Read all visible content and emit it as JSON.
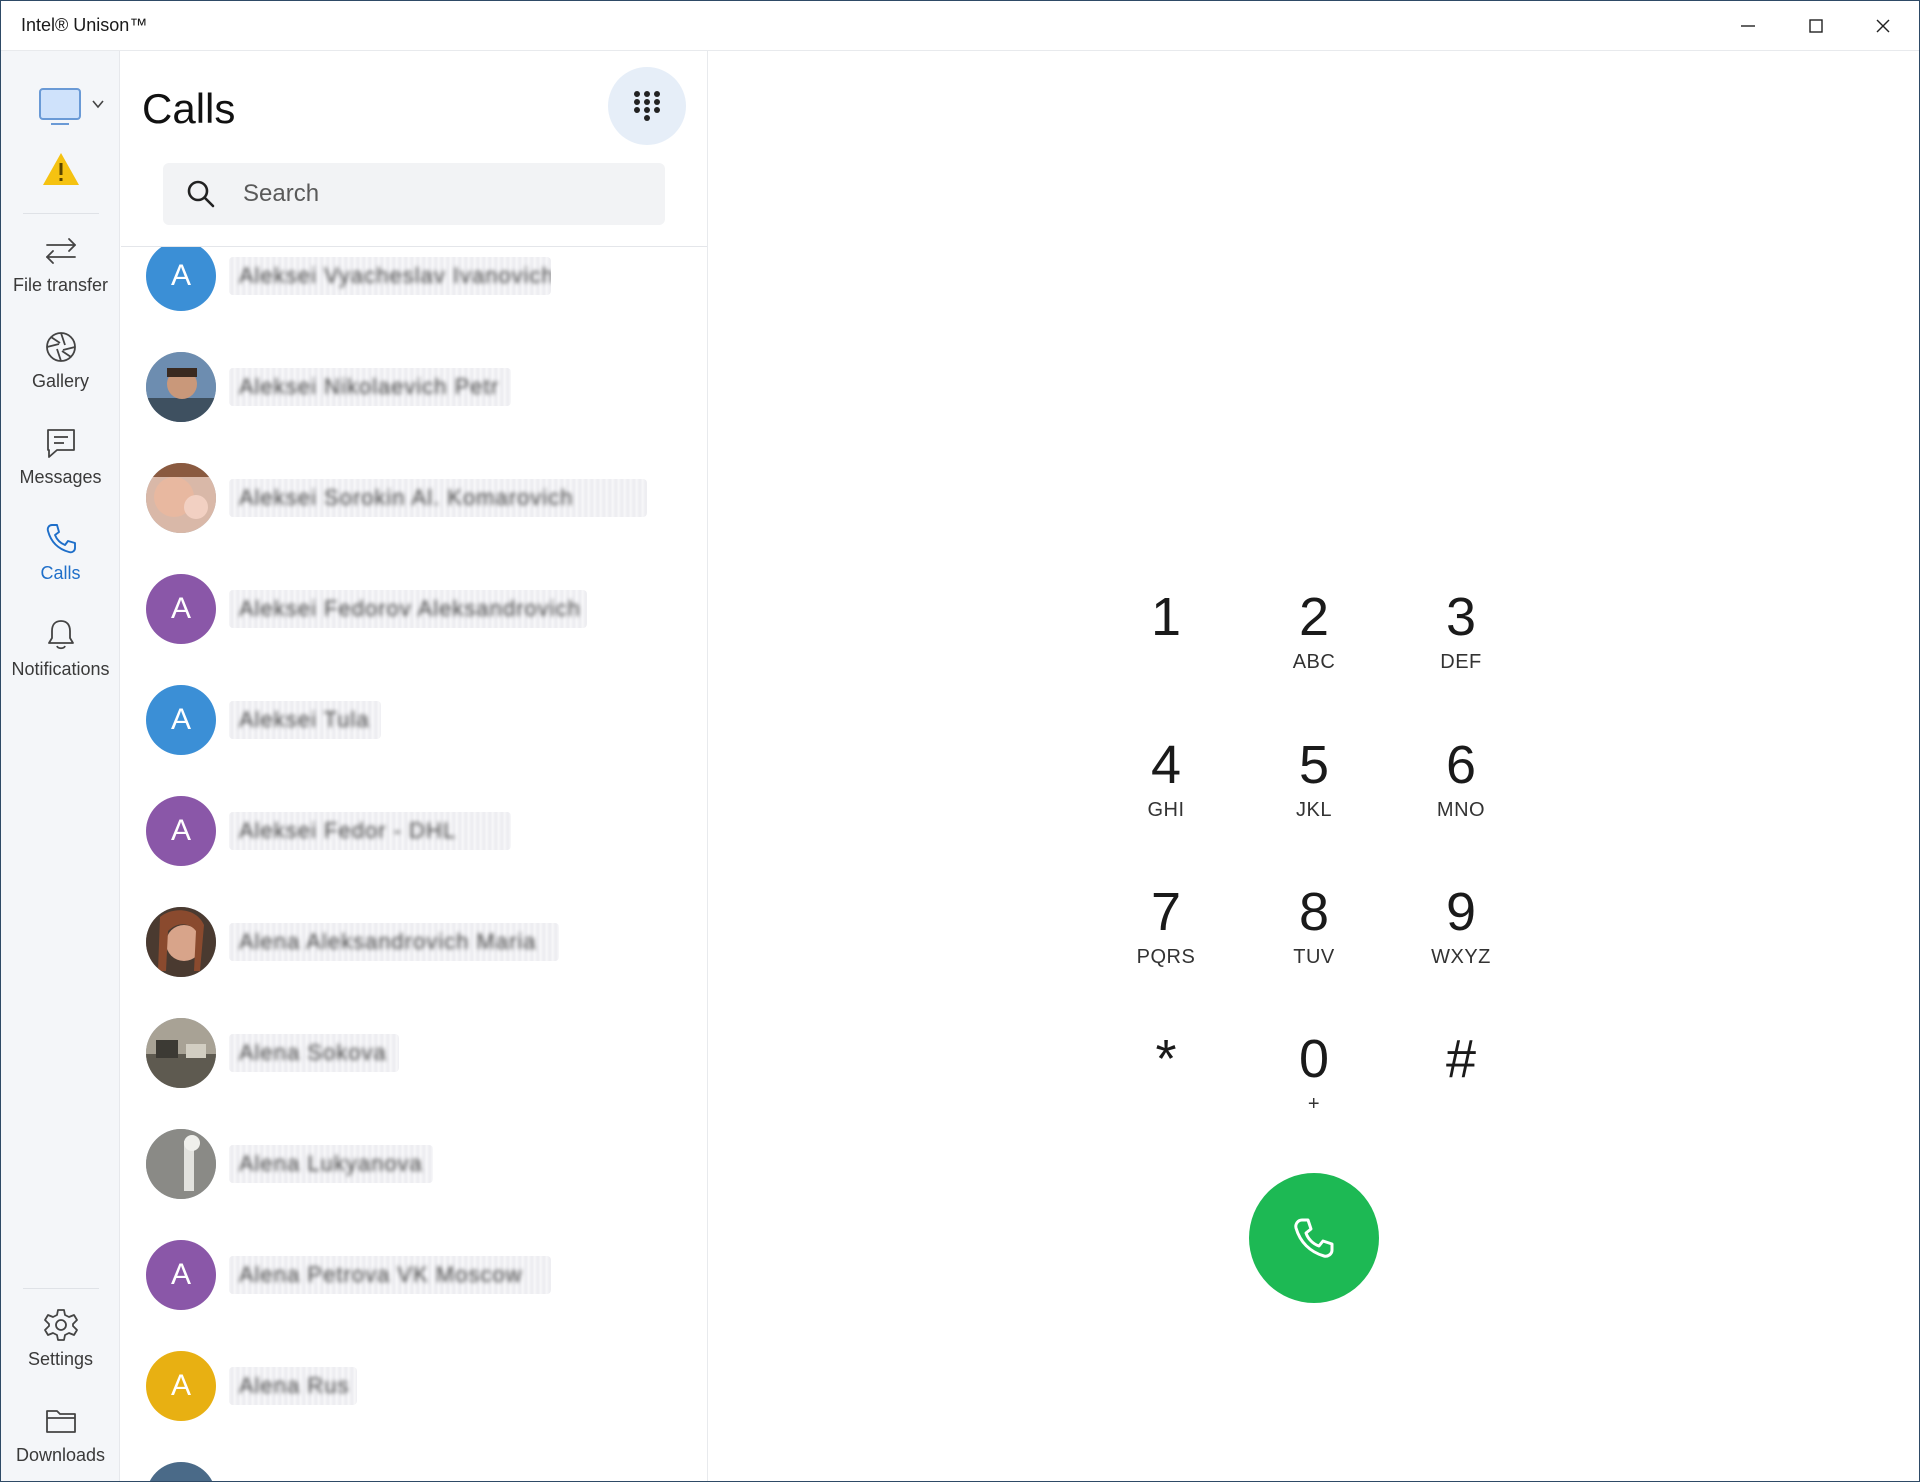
{
  "window": {
    "title": "Intel® Unison™"
  },
  "rail": {
    "items": [
      {
        "label": "File transfer",
        "icon": "file-transfer-icon"
      },
      {
        "label": "Gallery",
        "icon": "gallery-icon"
      },
      {
        "label": "Messages",
        "icon": "messages-icon"
      },
      {
        "label": "Calls",
        "icon": "calls-icon",
        "active": true
      },
      {
        "label": "Notifications",
        "icon": "notifications-icon"
      }
    ],
    "bottom_items": [
      {
        "label": "Settings",
        "icon": "settings-icon"
      },
      {
        "label": "Downloads",
        "icon": "downloads-icon"
      }
    ],
    "accent": "#1f6fc9"
  },
  "calls": {
    "title": "Calls",
    "search": {
      "placeholder": "Search",
      "value": ""
    },
    "contacts": [
      {
        "initial": "A",
        "avatar_color": "#3b8fd6",
        "name_blurred": "Aleksei Vyacheslav Ivanovich"
      },
      {
        "initial": "",
        "avatar_color": "photo",
        "name_blurred": "Aleksei Nikolaevich Petr"
      },
      {
        "initial": "",
        "avatar_color": "photo",
        "name_blurred": "Aleksei Sorokin Al. Komarovich"
      },
      {
        "initial": "A",
        "avatar_color": "#8a57a8",
        "name_blurred": "Aleksei Fedorov Aleksandrovich"
      },
      {
        "initial": "A",
        "avatar_color": "#3b8fd6",
        "name_blurred": "Aleksei Tula"
      },
      {
        "initial": "A",
        "avatar_color": "#8a57a8",
        "name_blurred": "Aleksei Fedor - DHL"
      },
      {
        "initial": "",
        "avatar_color": "photo",
        "name_blurred": "Alena Aleksandrovich Maria"
      },
      {
        "initial": "",
        "avatar_color": "photo",
        "name_blurred": "Alena Sokova"
      },
      {
        "initial": "",
        "avatar_color": "photo",
        "name_blurred": "Alena Lukyanova"
      },
      {
        "initial": "A",
        "avatar_color": "#8a57a8",
        "name_blurred": "Alena Petrova VK Moscow"
      },
      {
        "initial": "A",
        "avatar_color": "#e8b012",
        "name_blurred": "Alena Rus"
      }
    ]
  },
  "dialpad": {
    "keys": [
      {
        "digit": "1",
        "letters": ""
      },
      {
        "digit": "2",
        "letters": "ABC"
      },
      {
        "digit": "3",
        "letters": "DEF"
      },
      {
        "digit": "4",
        "letters": "GHI"
      },
      {
        "digit": "5",
        "letters": "JKL"
      },
      {
        "digit": "6",
        "letters": "MNO"
      },
      {
        "digit": "7",
        "letters": "PQRS"
      },
      {
        "digit": "8",
        "letters": "TUV"
      },
      {
        "digit": "9",
        "letters": "WXYZ"
      },
      {
        "digit": "*",
        "letters": ""
      },
      {
        "digit": "0",
        "letters": "+"
      },
      {
        "digit": "#",
        "letters": ""
      }
    ],
    "call_button_color": "#1db954"
  }
}
